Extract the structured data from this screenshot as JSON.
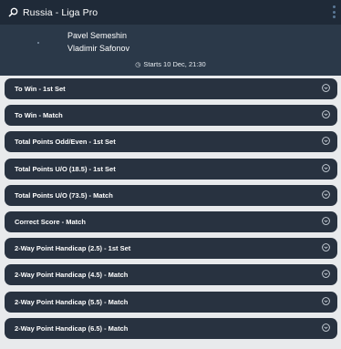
{
  "header": {
    "title": "Russia - Liga Pro"
  },
  "match": {
    "player1": "Pavel Semeshin",
    "player2": "Vladimir Safonov",
    "start_label": "Starts 10 Dec, 21:30"
  },
  "markets": [
    {
      "label": "To Win - 1st Set"
    },
    {
      "label": "To Win - Match"
    },
    {
      "label": "Total Points Odd/Even - 1st Set"
    },
    {
      "label": "Total Points U/O (18.5) - 1st Set"
    },
    {
      "label": "Total Points U/O (73.5) - Match"
    },
    {
      "label": "Correct Score - Match"
    },
    {
      "label": "2-Way Point Handicap (2.5) - 1st Set"
    },
    {
      "label": "2-Way Point Handicap (4.5) - Match"
    },
    {
      "label": "2-Way Point Handicap (5.5) - Match"
    },
    {
      "label": "2-Way Point Handicap (6.5) - Match"
    }
  ]
}
